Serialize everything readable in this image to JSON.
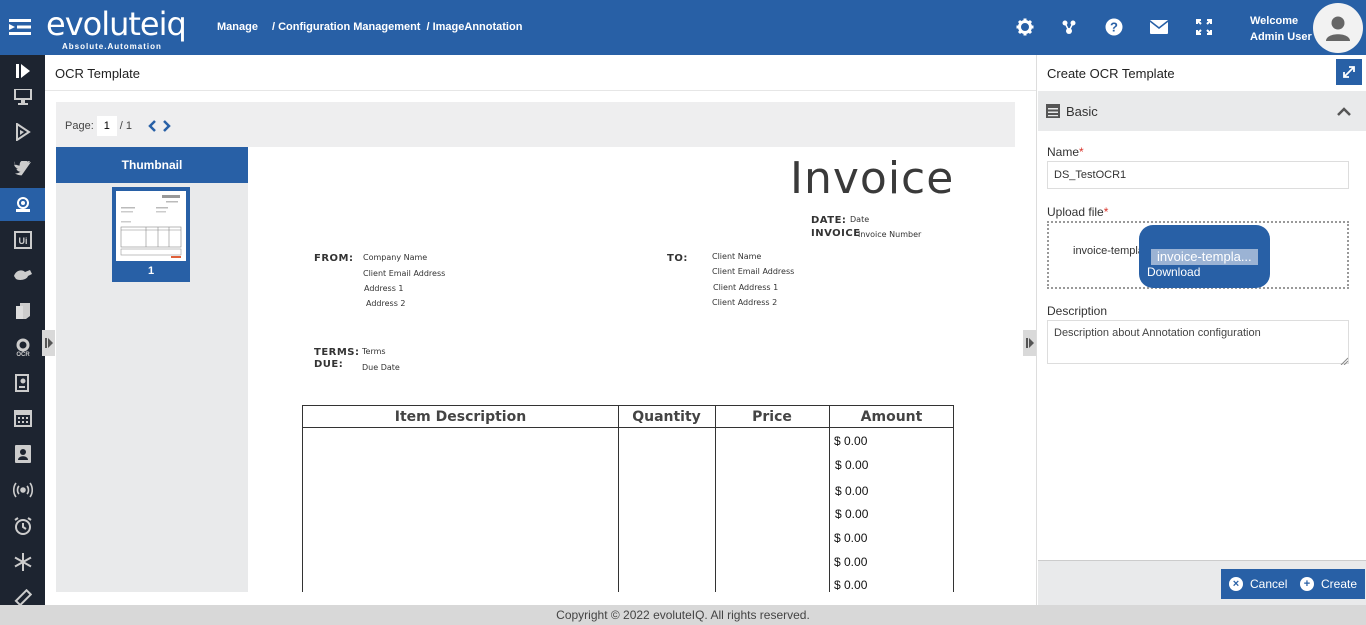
{
  "app": {
    "logo_text": "evoluteiq",
    "logo_tagline": "Absolute.Automation",
    "breadcrumb": [
      "Manage",
      "/ Configuration Management",
      "/ ImageAnnotation"
    ],
    "welcome_line1": "Welcome",
    "welcome_line2": "Admin User",
    "accent_color": "#2860a6",
    "nav_icons": [
      "collapse-sidebar-icon",
      "monitor-icon",
      "dynamics-icon",
      "twitter-icon",
      "annotation-icon",
      "uipath-icon",
      "automation-icon",
      "documents-icon",
      "ocr-icon",
      "form-icon",
      "calendar-icon",
      "contact-icon",
      "broadcast-icon",
      "alarm-icon",
      "snowflake-icon",
      "ruler-icon"
    ]
  },
  "main": {
    "title": "OCR Template",
    "pager": {
      "label": "Page:",
      "current": "1",
      "total": "/ 1"
    },
    "thumbnail": {
      "header": "Thumbnail",
      "number": "1"
    }
  },
  "invoice": {
    "title": "Invoice",
    "date_label": "DATE:",
    "date_value": "Date",
    "invoice_label": "INVOICE",
    "invoice_value": "Invoice Number",
    "from_label": "FROM:",
    "from_lines": [
      "Company Name",
      "Client Email Address",
      "Address 1",
      "Address 2"
    ],
    "to_label": "TO:",
    "to_lines": [
      "Client Name",
      "Client Email Address",
      "Client Address 1",
      "Client Address 2"
    ],
    "terms_label": "TERMS:",
    "terms_value": "Terms",
    "due_label": "DUE:",
    "due_value": "Due Date",
    "columns": [
      "Item Description",
      "Quantity",
      "Price",
      "Amount"
    ],
    "amounts": [
      "$ 0.00",
      "$ 0.00",
      "$ 0.00",
      "$ 0.00",
      "$ 0.00",
      "$ 0.00",
      "$ 0.00"
    ]
  },
  "form": {
    "title": "Create OCR Template",
    "section": "Basic",
    "name_label": "Name",
    "name_value": "DS_TestOCR1",
    "upload_label": "Upload file",
    "upload_filename": "invoice-templa",
    "tooltip_filename": "invoice-templa...",
    "tooltip_action": "Download",
    "description_label": "Description",
    "description_value": "Description about Annotation configuration",
    "cancel_label": "Cancel",
    "create_label": "Create"
  },
  "footer": {
    "copyright": "Copyright © 2022 evoluteIQ. All rights reserved."
  }
}
